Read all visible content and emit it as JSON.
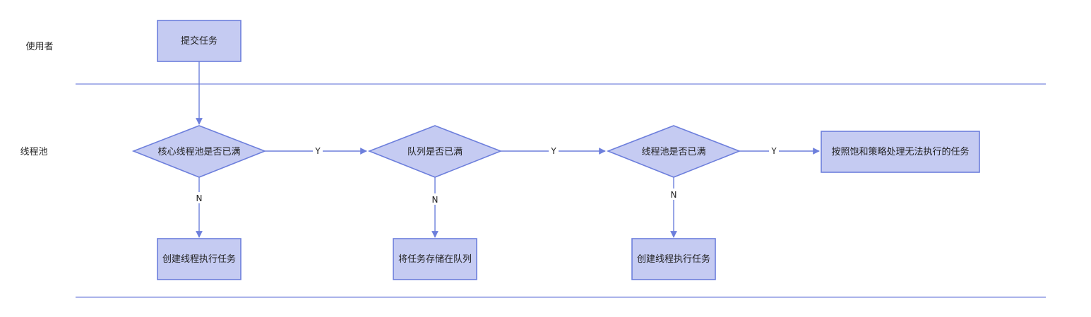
{
  "lanes": [
    {
      "label": "使用者"
    },
    {
      "label": "线程池"
    }
  ],
  "nodes": {
    "submit": {
      "label": "提交任务"
    },
    "core_full": {
      "label": "核心线程池是否已满"
    },
    "queue_full": {
      "label": "队列是否已满"
    },
    "pool_full": {
      "label": "线程池是否已满"
    },
    "reject": {
      "label": "按照饱和策略处理无法执行的任务"
    },
    "create_core": {
      "label": "创建线程执行任务"
    },
    "enqueue": {
      "label": "将任务存储在队列"
    },
    "create_thread": {
      "label": "创建线程执行任务"
    }
  },
  "edge_labels": {
    "yes": "Y",
    "no": "N"
  },
  "colors": {
    "fill": "#c5cbf2",
    "stroke": "#6d7fdc",
    "divider": "#8e9ae3"
  }
}
